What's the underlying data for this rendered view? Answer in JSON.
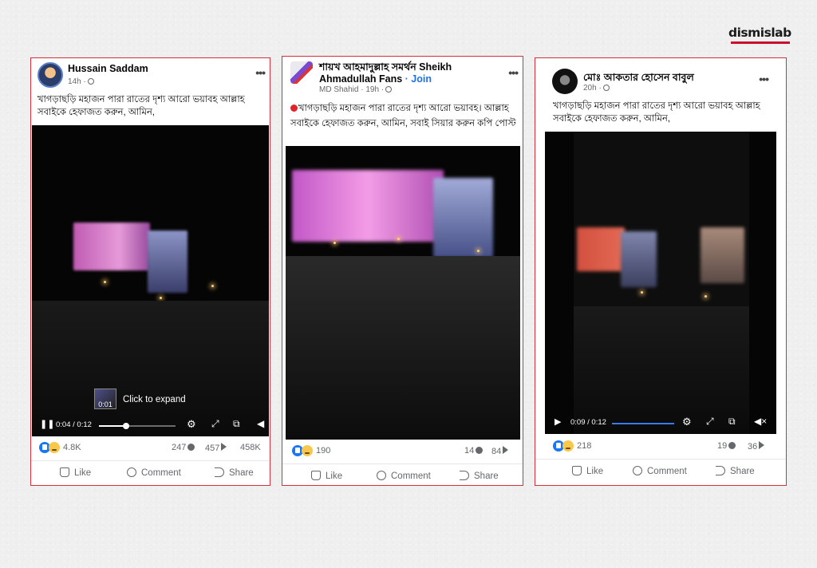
{
  "brand": {
    "logo_text": "dismislab",
    "accent": "#c8102e"
  },
  "posts": [
    {
      "author": "Hussain Saddam",
      "meta": "14h ·",
      "caption": "খাগড়াছড়ি মহাজন পারা রাতের দৃশ্য আরো ভয়াবহ আল্লাহ সবাইকে হেফাজত করুন, আমিন,",
      "video": {
        "overlay_time": "0:01",
        "overlay_text": "Click to expand",
        "time": "0:04 / 0:12",
        "progress": 0.33
      },
      "stats": {
        "reactions": "4.8K",
        "comments": "247",
        "shares": "457",
        "views": "458K"
      },
      "actions": {
        "like": "Like",
        "comment": "Comment",
        "share": "Share"
      }
    },
    {
      "author_bn": "শায়খ আহমাদুল্লাহ সমর্থন",
      "author_en": "Sheikh Ahmadullah Fans",
      "join": "· Join",
      "meta": "MD Shahid · 19h ·",
      "caption": "খাগড়াছড়ি মহাজন পারা রাতের দৃশ্য আরো ভয়াবহ। আল্লাহ সবাইকে হেফাজত করুন, আমিন, সবাই সিয়ার করুন কপি পোস্ট",
      "stats": {
        "reactions": "190",
        "comments": "14",
        "shares": "84"
      },
      "actions": {
        "like": "Like",
        "comment": "Comment",
        "share": "Share"
      }
    },
    {
      "author": "মোঃ আকতার হোসেন বাবুল",
      "meta": "20h ·",
      "caption": "খাগড়াছড়ি মহাজন পারা রাতের দৃশ্য আরো ভয়াবহ আল্লাহ সবাইকে হেফাজত করুন, আমিন,",
      "video": {
        "time": "0:09 / 0:12",
        "progress": 0.75
      },
      "stats": {
        "reactions": "218",
        "comments": "19",
        "shares": "36"
      },
      "actions": {
        "like": "Like",
        "comment": "Comment",
        "share": "Share"
      }
    }
  ]
}
